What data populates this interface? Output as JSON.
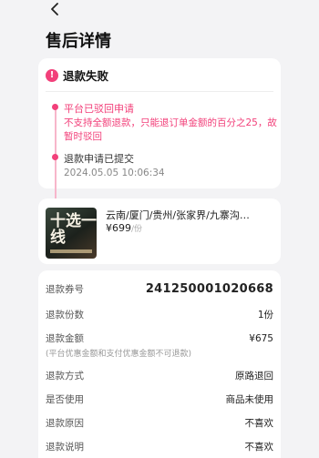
{
  "header": {
    "title": "售后详情"
  },
  "status": {
    "label": "退款失败",
    "color": "#f2407a",
    "timeline": [
      {
        "title": "平台已驳回申请",
        "desc": "不支持全额退款，只能退订单金额的百分之25，故暂时驳回"
      },
      {
        "title": "退款申请已提交",
        "time": "2024.05.05  10:06:34"
      }
    ]
  },
  "product": {
    "thumbnail_text": "十选一线",
    "name": "云南/厦门/贵州/张家界/九寨沟…",
    "price": "¥699",
    "price_unit": "/份"
  },
  "details": {
    "rows": [
      {
        "key": "退款券号",
        "value": "241250001020668"
      },
      {
        "key": "退款份数",
        "value": "1份"
      },
      {
        "key": "退款金额",
        "value": "¥675"
      },
      {
        "key": "退款方式",
        "value": "原路退回"
      },
      {
        "key": "是否使用",
        "value": "商品未使用"
      },
      {
        "key": "退款原因",
        "value": "不喜欢"
      },
      {
        "key": "退款说明",
        "value": "不喜欢"
      }
    ],
    "note": "(平台优惠金额和支付优惠金额不可退款)"
  }
}
